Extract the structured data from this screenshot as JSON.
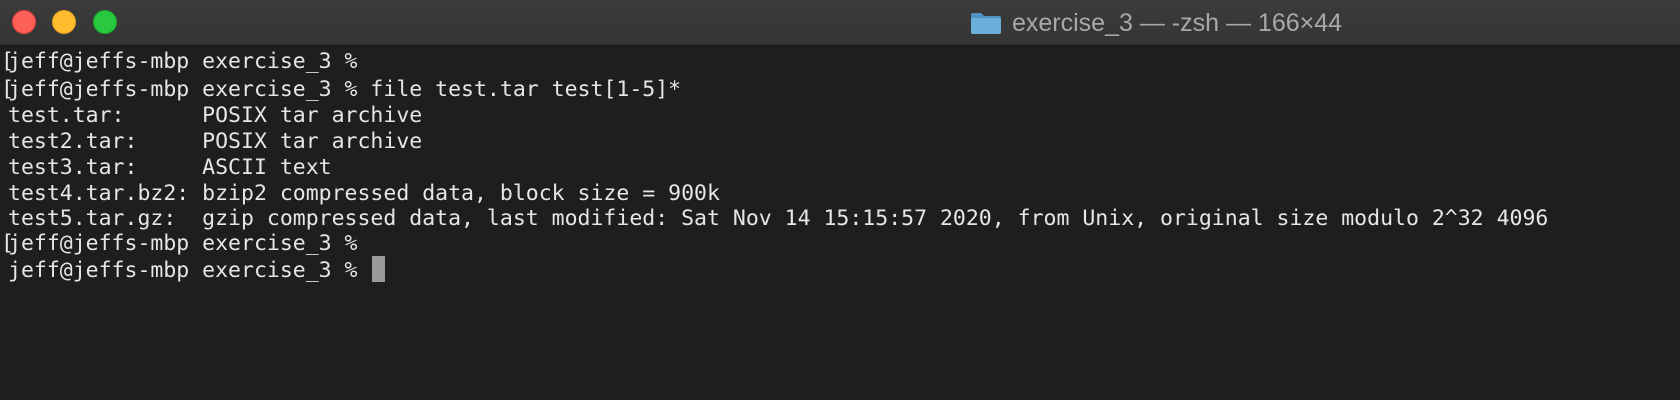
{
  "window": {
    "title": "exercise_3 — -zsh — 166×44"
  },
  "icons": {
    "close": "close-button",
    "minimize": "minimize-button",
    "maximize": "maximize-button",
    "folder": "folder-icon"
  },
  "colors": {
    "background": "#1e1e1e",
    "text": "#e6e6e6",
    "close": "#fe5f57",
    "minimize": "#febc2e",
    "maximize": "#28c840",
    "folder": "#6aaed9"
  },
  "terminal": {
    "bracket": "[",
    "lines": [
      "jeff@jeffs-mbp exercise_3 %",
      "jeff@jeffs-mbp exercise_3 % file test.tar test[1-5]*",
      "test.tar:      POSIX tar archive",
      "test2.tar:     POSIX tar archive",
      "test3.tar:     ASCII text",
      "test4.tar.bz2: bzip2 compressed data, block size = 900k",
      "test5.tar.gz:  gzip compressed data, last modified: Sat Nov 14 15:15:57 2020, from Unix, original size modulo 2^32 4096",
      "jeff@jeffs-mbp exercise_3 %",
      "jeff@jeffs-mbp exercise_3 % "
    ]
  }
}
